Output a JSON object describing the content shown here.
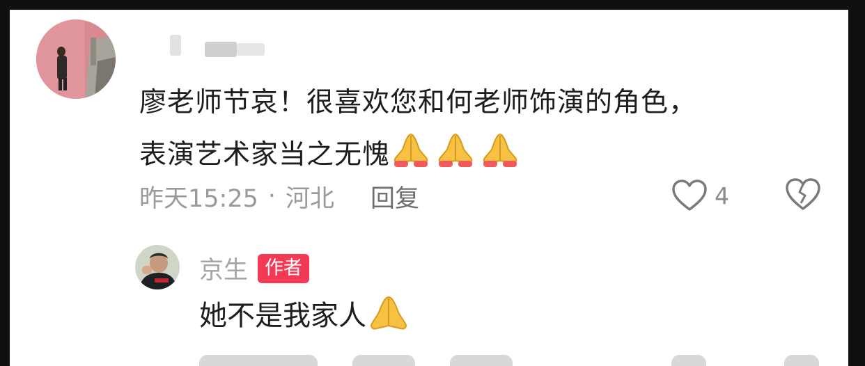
{
  "comment": {
    "text_line1": "廖老师节哀！很喜欢您和何老师饰演的角色，",
    "text_line2": "表演艺术家当之无愧",
    "emojis": [
      "folded-hands-emoji",
      "folded-hands-emoji",
      "folded-hands-emoji"
    ],
    "time": "昨天15:25",
    "separator": "·",
    "location": "河北",
    "reply_label": "回复",
    "like_count": "4"
  },
  "reply": {
    "author": "京生",
    "badge": "作者",
    "text": "她不是我家人",
    "emojis": [
      "folded-hands-emoji"
    ]
  },
  "colors": {
    "badge": "#f33a55",
    "meta": "#9a9a9a",
    "text": "#1d1d1d"
  }
}
